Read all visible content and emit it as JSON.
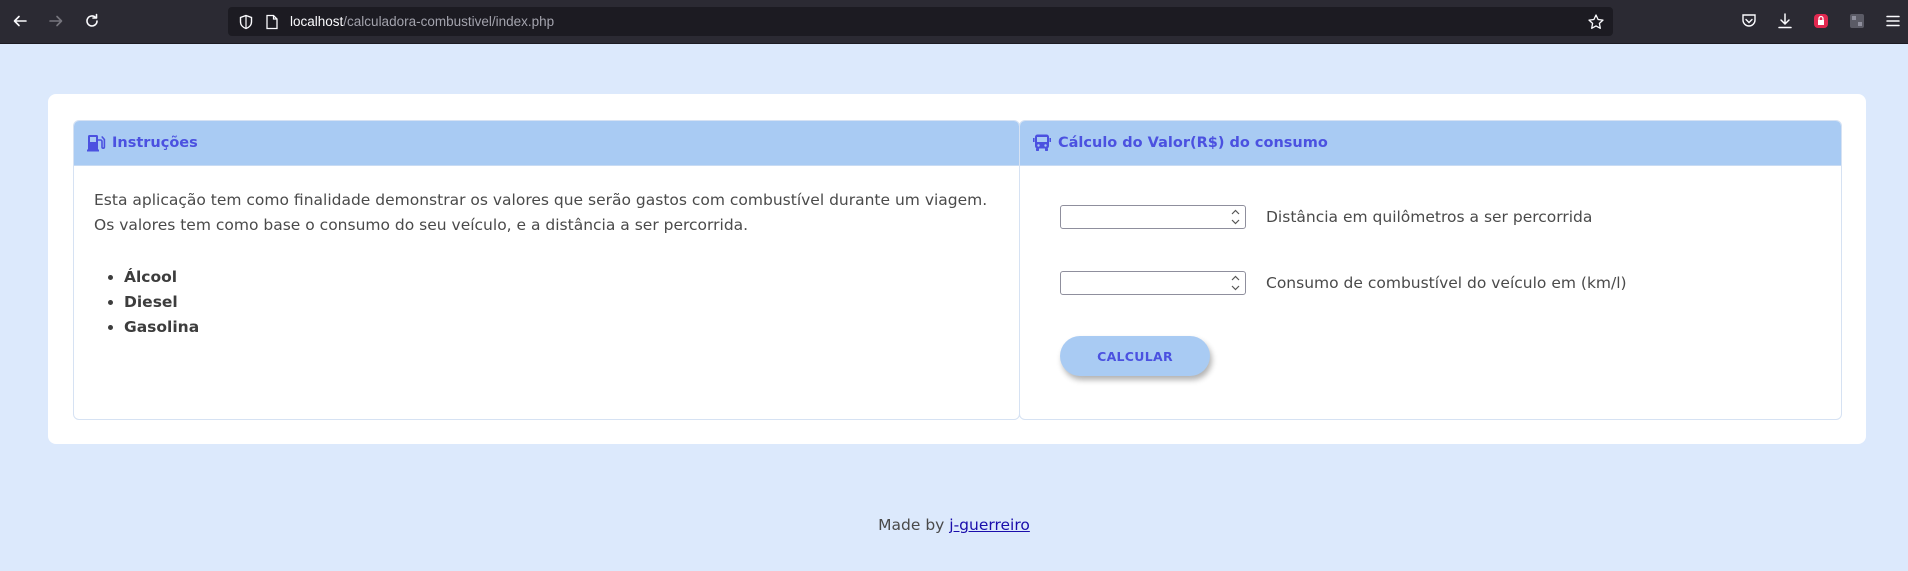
{
  "browser": {
    "url_host": "localhost",
    "url_path": "/calculadora-combustivel/index.php"
  },
  "instructions": {
    "title": "Instruções",
    "paragraph": "Esta aplicação tem como finalidade demonstrar os valores que serão gastos com combustível durante um viagem. Os valores tem como base o consumo do seu veículo, e a distância a ser percorrida.",
    "fuels": [
      "Álcool",
      "Diesel",
      "Gasolina"
    ]
  },
  "calculator": {
    "title": "Cálculo do Valor(R$) do consumo",
    "distance_value": "",
    "distance_label": "Distância em quilômetros a ser percorrida",
    "consumption_value": "",
    "consumption_label": "Consumo de combustível do veículo em (km/l)",
    "button_label": "CALCULAR"
  },
  "footer": {
    "prefix": "Made by",
    "author_link": "j-guerreiro"
  },
  "colors": {
    "page_bg": "#dce9fc",
    "header_bg": "#a9cbf3",
    "accent_text": "#4b51e0"
  }
}
